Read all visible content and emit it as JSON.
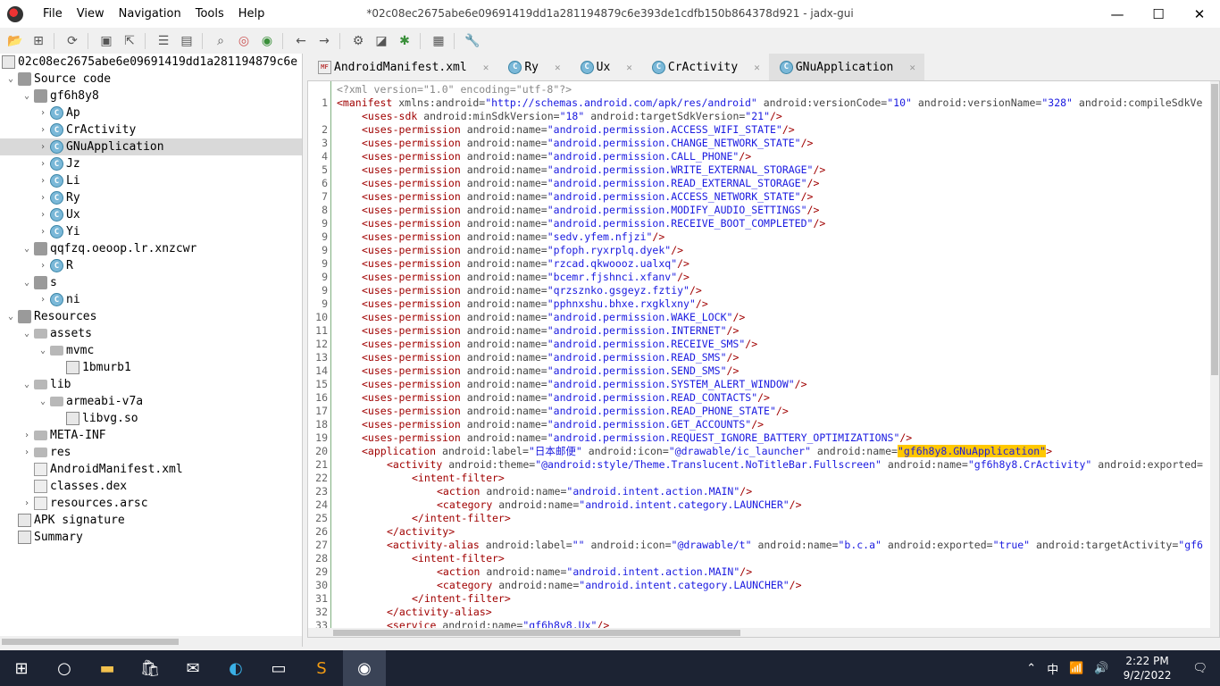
{
  "window": {
    "title": "*02c08ec2675abe6e09691419dd1a281194879c6e393de1cdfb150b864378d921 - jadx-gui",
    "menu": [
      "File",
      "View",
      "Navigation",
      "Tools",
      "Help"
    ],
    "controls": {
      "minimize": "—",
      "maximize": "☐",
      "close": "✕"
    }
  },
  "toolbar": {
    "icons": [
      "open-folder-icon",
      "add-files-icon",
      "sync-icon",
      "save-icon",
      "export-icon",
      "flatten-packages-icon",
      "go-to-folder-icon",
      "search-icon",
      "find-class-icon",
      "find-usage-icon",
      "back-icon",
      "forward-icon",
      "deobfuscate-icon",
      "quark-icon",
      "decompile-all-icon",
      "log-viewer-icon",
      "settings-wrench-icon"
    ]
  },
  "tree": {
    "root": "02c08ec2675abe6e09691419dd1a281194879c6e",
    "items": [
      {
        "label": "Source code",
        "depth": 0,
        "arrow": "⌄",
        "icon": "package"
      },
      {
        "label": "gf6h8y8",
        "depth": 1,
        "arrow": "⌄",
        "icon": "package"
      },
      {
        "label": "Ap",
        "depth": 2,
        "arrow": "›",
        "icon": "class"
      },
      {
        "label": "CrActivity",
        "depth": 2,
        "arrow": "›",
        "icon": "class"
      },
      {
        "label": "GNuApplication",
        "depth": 2,
        "arrow": "›",
        "icon": "class",
        "selected": true
      },
      {
        "label": "Jz",
        "depth": 2,
        "arrow": "›",
        "icon": "class"
      },
      {
        "label": "Li",
        "depth": 2,
        "arrow": "›",
        "icon": "class"
      },
      {
        "label": "Ry",
        "depth": 2,
        "arrow": "›",
        "icon": "class"
      },
      {
        "label": "Ux",
        "depth": 2,
        "arrow": "›",
        "icon": "class"
      },
      {
        "label": "Yi",
        "depth": 2,
        "arrow": "›",
        "icon": "class"
      },
      {
        "label": "qqfzq.oeoop.lr.xnzcwr",
        "depth": 1,
        "arrow": "⌄",
        "icon": "package"
      },
      {
        "label": "R",
        "depth": 2,
        "arrow": "›",
        "icon": "class"
      },
      {
        "label": "s",
        "depth": 1,
        "arrow": "⌄",
        "icon": "package"
      },
      {
        "label": "ni",
        "depth": 2,
        "arrow": "›",
        "icon": "class"
      },
      {
        "label": "Resources",
        "depth": 0,
        "arrow": "⌄",
        "icon": "package"
      },
      {
        "label": "assets",
        "depth": 1,
        "arrow": "⌄",
        "icon": "folder"
      },
      {
        "label": "mvmc",
        "depth": 2,
        "arrow": "⌄",
        "icon": "folder"
      },
      {
        "label": "1bmurb1",
        "depth": 3,
        "arrow": "",
        "icon": "res"
      },
      {
        "label": "lib",
        "depth": 1,
        "arrow": "⌄",
        "icon": "folder"
      },
      {
        "label": "armeabi-v7a",
        "depth": 2,
        "arrow": "⌄",
        "icon": "folder"
      },
      {
        "label": "libvg.so",
        "depth": 3,
        "arrow": "",
        "icon": "res"
      },
      {
        "label": "META-INF",
        "depth": 1,
        "arrow": "›",
        "icon": "folder"
      },
      {
        "label": "res",
        "depth": 1,
        "arrow": "›",
        "icon": "folder"
      },
      {
        "label": "AndroidManifest.xml",
        "depth": 1,
        "arrow": "",
        "icon": "file"
      },
      {
        "label": "classes.dex",
        "depth": 1,
        "arrow": "",
        "icon": "file"
      },
      {
        "label": "resources.arsc",
        "depth": 1,
        "arrow": "›",
        "icon": "file"
      },
      {
        "label": "APK signature",
        "depth": 0,
        "arrow": "",
        "icon": "res"
      },
      {
        "label": "Summary",
        "depth": 0,
        "arrow": "",
        "icon": "res"
      }
    ]
  },
  "tabs": [
    {
      "label": "AndroidManifest.xml",
      "icon": "MF",
      "close": "✕",
      "active": false
    },
    {
      "label": "Ry",
      "icon": "C",
      "close": "✕",
      "active": false
    },
    {
      "label": "Ux",
      "icon": "C",
      "close": "✕",
      "active": false
    },
    {
      "label": "CrActivity",
      "icon": "C",
      "close": "✕",
      "active": false
    },
    {
      "label": "GNuApplication",
      "icon": "C",
      "close": "✕",
      "active": true
    }
  ],
  "code": [
    {
      "n": "",
      "i": 0,
      "parts": [
        [
          "g",
          "<?xml version=\"1.0\" encoding=\"utf-8\"?>"
        ]
      ]
    },
    {
      "n": "1",
      "i": 0,
      "parts": [
        [
          "t",
          "<manifest "
        ],
        [
          "a",
          "xmlns:android="
        ],
        [
          "v",
          "\"http://schemas.android.com/apk/res/android\""
        ],
        [
          "a",
          " android:versionCode="
        ],
        [
          "v",
          "\"10\""
        ],
        [
          "a",
          " android:versionName="
        ],
        [
          "v",
          "\"328\""
        ],
        [
          "a",
          " android:compileSdkVe"
        ]
      ]
    },
    {
      "n": "",
      "i": 1,
      "parts": [
        [
          "t",
          "<uses-sdk "
        ],
        [
          "a",
          "android:minSdkVersion="
        ],
        [
          "v",
          "\"18\""
        ],
        [
          "a",
          " android:targetSdkVersion="
        ],
        [
          "v",
          "\"21\""
        ],
        [
          "t",
          "/>"
        ]
      ]
    },
    {
      "n": "2",
      "i": 1,
      "parts": [
        [
          "t",
          "<uses-permission "
        ],
        [
          "a",
          "android:name="
        ],
        [
          "v",
          "\"android.permission.ACCESS_WIFI_STATE\""
        ],
        [
          "t",
          "/>"
        ]
      ]
    },
    {
      "n": "3",
      "i": 1,
      "parts": [
        [
          "t",
          "<uses-permission "
        ],
        [
          "a",
          "android:name="
        ],
        [
          "v",
          "\"android.permission.CHANGE_NETWORK_STATE\""
        ],
        [
          "t",
          "/>"
        ]
      ]
    },
    {
      "n": "4",
      "i": 1,
      "parts": [
        [
          "t",
          "<uses-permission "
        ],
        [
          "a",
          "android:name="
        ],
        [
          "v",
          "\"android.permission.CALL_PHONE\""
        ],
        [
          "t",
          "/>"
        ]
      ]
    },
    {
      "n": "5",
      "i": 1,
      "parts": [
        [
          "t",
          "<uses-permission "
        ],
        [
          "a",
          "android:name="
        ],
        [
          "v",
          "\"android.permission.WRITE_EXTERNAL_STORAGE\""
        ],
        [
          "t",
          "/>"
        ]
      ]
    },
    {
      "n": "6",
      "i": 1,
      "parts": [
        [
          "t",
          "<uses-permission "
        ],
        [
          "a",
          "android:name="
        ],
        [
          "v",
          "\"android.permission.READ_EXTERNAL_STORAGE\""
        ],
        [
          "t",
          "/>"
        ]
      ]
    },
    {
      "n": "7",
      "i": 1,
      "parts": [
        [
          "t",
          "<uses-permission "
        ],
        [
          "a",
          "android:name="
        ],
        [
          "v",
          "\"android.permission.ACCESS_NETWORK_STATE\""
        ],
        [
          "t",
          "/>"
        ]
      ]
    },
    {
      "n": "8",
      "i": 1,
      "parts": [
        [
          "t",
          "<uses-permission "
        ],
        [
          "a",
          "android:name="
        ],
        [
          "v",
          "\"android.permission.MODIFY_AUDIO_SETTINGS\""
        ],
        [
          "t",
          "/>"
        ]
      ]
    },
    {
      "n": "9",
      "i": 1,
      "parts": [
        [
          "t",
          "<uses-permission "
        ],
        [
          "a",
          "android:name="
        ],
        [
          "v",
          "\"android.permission.RECEIVE_BOOT_COMPLETED\""
        ],
        [
          "t",
          "/>"
        ]
      ]
    },
    {
      "n": "9",
      "i": 1,
      "parts": [
        [
          "t",
          "<uses-permission "
        ],
        [
          "a",
          "android:name="
        ],
        [
          "v",
          "\"sedv.yfem.nfjzi\""
        ],
        [
          "t",
          "/>"
        ]
      ]
    },
    {
      "n": "9",
      "i": 1,
      "parts": [
        [
          "t",
          "<uses-permission "
        ],
        [
          "a",
          "android:name="
        ],
        [
          "v",
          "\"pfoph.ryxrplq.dyek\""
        ],
        [
          "t",
          "/>"
        ]
      ]
    },
    {
      "n": "9",
      "i": 1,
      "parts": [
        [
          "t",
          "<uses-permission "
        ],
        [
          "a",
          "android:name="
        ],
        [
          "v",
          "\"rzcad.qkwoooz.ualxq\""
        ],
        [
          "t",
          "/>"
        ]
      ]
    },
    {
      "n": "9",
      "i": 1,
      "parts": [
        [
          "t",
          "<uses-permission "
        ],
        [
          "a",
          "android:name="
        ],
        [
          "v",
          "\"bcemr.fjshnci.xfanv\""
        ],
        [
          "t",
          "/>"
        ]
      ]
    },
    {
      "n": "9",
      "i": 1,
      "parts": [
        [
          "t",
          "<uses-permission "
        ],
        [
          "a",
          "android:name="
        ],
        [
          "v",
          "\"qrzsznko.gsgeyz.fztiy\""
        ],
        [
          "t",
          "/>"
        ]
      ]
    },
    {
      "n": "9",
      "i": 1,
      "parts": [
        [
          "t",
          "<uses-permission "
        ],
        [
          "a",
          "android:name="
        ],
        [
          "v",
          "\"pphnxshu.bhxe.rxgklxny\""
        ],
        [
          "t",
          "/>"
        ]
      ]
    },
    {
      "n": "10",
      "i": 1,
      "parts": [
        [
          "t",
          "<uses-permission "
        ],
        [
          "a",
          "android:name="
        ],
        [
          "v",
          "\"android.permission.WAKE_LOCK\""
        ],
        [
          "t",
          "/>"
        ]
      ]
    },
    {
      "n": "11",
      "i": 1,
      "parts": [
        [
          "t",
          "<uses-permission "
        ],
        [
          "a",
          "android:name="
        ],
        [
          "v",
          "\"android.permission.INTERNET\""
        ],
        [
          "t",
          "/>"
        ]
      ]
    },
    {
      "n": "12",
      "i": 1,
      "parts": [
        [
          "t",
          "<uses-permission "
        ],
        [
          "a",
          "android:name="
        ],
        [
          "v",
          "\"android.permission.RECEIVE_SMS\""
        ],
        [
          "t",
          "/>"
        ]
      ]
    },
    {
      "n": "13",
      "i": 1,
      "parts": [
        [
          "t",
          "<uses-permission "
        ],
        [
          "a",
          "android:name="
        ],
        [
          "v",
          "\"android.permission.READ_SMS\""
        ],
        [
          "t",
          "/>"
        ]
      ]
    },
    {
      "n": "14",
      "i": 1,
      "parts": [
        [
          "t",
          "<uses-permission "
        ],
        [
          "a",
          "android:name="
        ],
        [
          "v",
          "\"android.permission.SEND_SMS\""
        ],
        [
          "t",
          "/>"
        ]
      ]
    },
    {
      "n": "15",
      "i": 1,
      "parts": [
        [
          "t",
          "<uses-permission "
        ],
        [
          "a",
          "android:name="
        ],
        [
          "v",
          "\"android.permission.SYSTEM_ALERT_WINDOW\""
        ],
        [
          "t",
          "/>"
        ]
      ]
    },
    {
      "n": "16",
      "i": 1,
      "parts": [
        [
          "t",
          "<uses-permission "
        ],
        [
          "a",
          "android:name="
        ],
        [
          "v",
          "\"android.permission.READ_CONTACTS\""
        ],
        [
          "t",
          "/>"
        ]
      ]
    },
    {
      "n": "17",
      "i": 1,
      "parts": [
        [
          "t",
          "<uses-permission "
        ],
        [
          "a",
          "android:name="
        ],
        [
          "v",
          "\"android.permission.READ_PHONE_STATE\""
        ],
        [
          "t",
          "/>"
        ]
      ]
    },
    {
      "n": "18",
      "i": 1,
      "parts": [
        [
          "t",
          "<uses-permission "
        ],
        [
          "a",
          "android:name="
        ],
        [
          "v",
          "\"android.permission.GET_ACCOUNTS\""
        ],
        [
          "t",
          "/>"
        ]
      ]
    },
    {
      "n": "19",
      "i": 1,
      "parts": [
        [
          "t",
          "<uses-permission "
        ],
        [
          "a",
          "android:name="
        ],
        [
          "v",
          "\"android.permission.REQUEST_IGNORE_BATTERY_OPTIMIZATIONS\""
        ],
        [
          "t",
          "/>"
        ]
      ]
    },
    {
      "n": "20",
      "i": 1,
      "parts": [
        [
          "t",
          "<application "
        ],
        [
          "a",
          "android:label="
        ],
        [
          "v",
          "\"日本邮便\""
        ],
        [
          "a",
          " android:icon="
        ],
        [
          "v",
          "\"@drawable/ic_launcher\""
        ],
        [
          "a",
          " android:name="
        ],
        [
          "hl",
          "\"gf6h8y8.GNuApplication\""
        ],
        [
          "t",
          ">"
        ]
      ]
    },
    {
      "n": "21",
      "i": 2,
      "parts": [
        [
          "t",
          "<activity "
        ],
        [
          "a",
          "android:theme="
        ],
        [
          "v",
          "\"@android:style/Theme.Translucent.NoTitleBar.Fullscreen\""
        ],
        [
          "a",
          " android:name="
        ],
        [
          "v",
          "\"gf6h8y8.CrActivity\""
        ],
        [
          "a",
          " android:exported="
        ]
      ]
    },
    {
      "n": "22",
      "i": 3,
      "parts": [
        [
          "t",
          "<intent-filter>"
        ]
      ]
    },
    {
      "n": "23",
      "i": 4,
      "parts": [
        [
          "t",
          "<action "
        ],
        [
          "a",
          "android:name="
        ],
        [
          "v",
          "\"android.intent.action.MAIN\""
        ],
        [
          "t",
          "/>"
        ]
      ]
    },
    {
      "n": "24",
      "i": 4,
      "parts": [
        [
          "t",
          "<category "
        ],
        [
          "a",
          "android:name="
        ],
        [
          "v",
          "\"android.intent.category.LAUNCHER\""
        ],
        [
          "t",
          "/>"
        ]
      ]
    },
    {
      "n": "25",
      "i": 3,
      "parts": [
        [
          "t",
          "</intent-filter>"
        ]
      ]
    },
    {
      "n": "26",
      "i": 2,
      "parts": [
        [
          "t",
          "</activity>"
        ]
      ]
    },
    {
      "n": "27",
      "i": 2,
      "parts": [
        [
          "t",
          "<activity-alias "
        ],
        [
          "a",
          "android:label="
        ],
        [
          "v",
          "\"\""
        ],
        [
          "a",
          " android:icon="
        ],
        [
          "v",
          "\"@drawable/t\""
        ],
        [
          "a",
          " android:name="
        ],
        [
          "v",
          "\"b.c.a\""
        ],
        [
          "a",
          " android:exported="
        ],
        [
          "v",
          "\"true\""
        ],
        [
          "a",
          " android:targetActivity="
        ],
        [
          "v",
          "\"gf6"
        ]
      ]
    },
    {
      "n": "28",
      "i": 3,
      "parts": [
        [
          "t",
          "<intent-filter>"
        ]
      ]
    },
    {
      "n": "29",
      "i": 4,
      "parts": [
        [
          "t",
          "<action "
        ],
        [
          "a",
          "android:name="
        ],
        [
          "v",
          "\"android.intent.action.MAIN\""
        ],
        [
          "t",
          "/>"
        ]
      ]
    },
    {
      "n": "30",
      "i": 4,
      "parts": [
        [
          "t",
          "<category "
        ],
        [
          "a",
          "android:name="
        ],
        [
          "v",
          "\"android.intent.category.LAUNCHER\""
        ],
        [
          "t",
          "/>"
        ]
      ]
    },
    {
      "n": "31",
      "i": 3,
      "parts": [
        [
          "t",
          "</intent-filter>"
        ]
      ]
    },
    {
      "n": "32",
      "i": 2,
      "parts": [
        [
          "t",
          "</activity-alias>"
        ]
      ]
    },
    {
      "n": "33",
      "i": 2,
      "parts": [
        [
          "t",
          "<service "
        ],
        [
          "a",
          "android:name="
        ],
        [
          "v",
          "\"gf6h8y8.Ux\""
        ],
        [
          "t",
          "/>"
        ]
      ]
    }
  ],
  "taskbar": {
    "apps": [
      "windows-start-icon",
      "cortana-circle-icon",
      "file-explorer-icon",
      "store-icon",
      "mail-icon",
      "edge-icon",
      "terminal-icon",
      "sublime-icon",
      "jadx-icon"
    ],
    "tray": {
      "chevron": "⌃",
      "ime": "中",
      "wifi": "📶",
      "volume": "🔊"
    },
    "time": "2:22 PM",
    "date": "9/2/2022",
    "notification": "🗨"
  },
  "colors": {
    "tag": "#a00000",
    "value": "#1a1ae0",
    "highlight": "#ffc800",
    "selected_row": "#d9d9d9"
  }
}
